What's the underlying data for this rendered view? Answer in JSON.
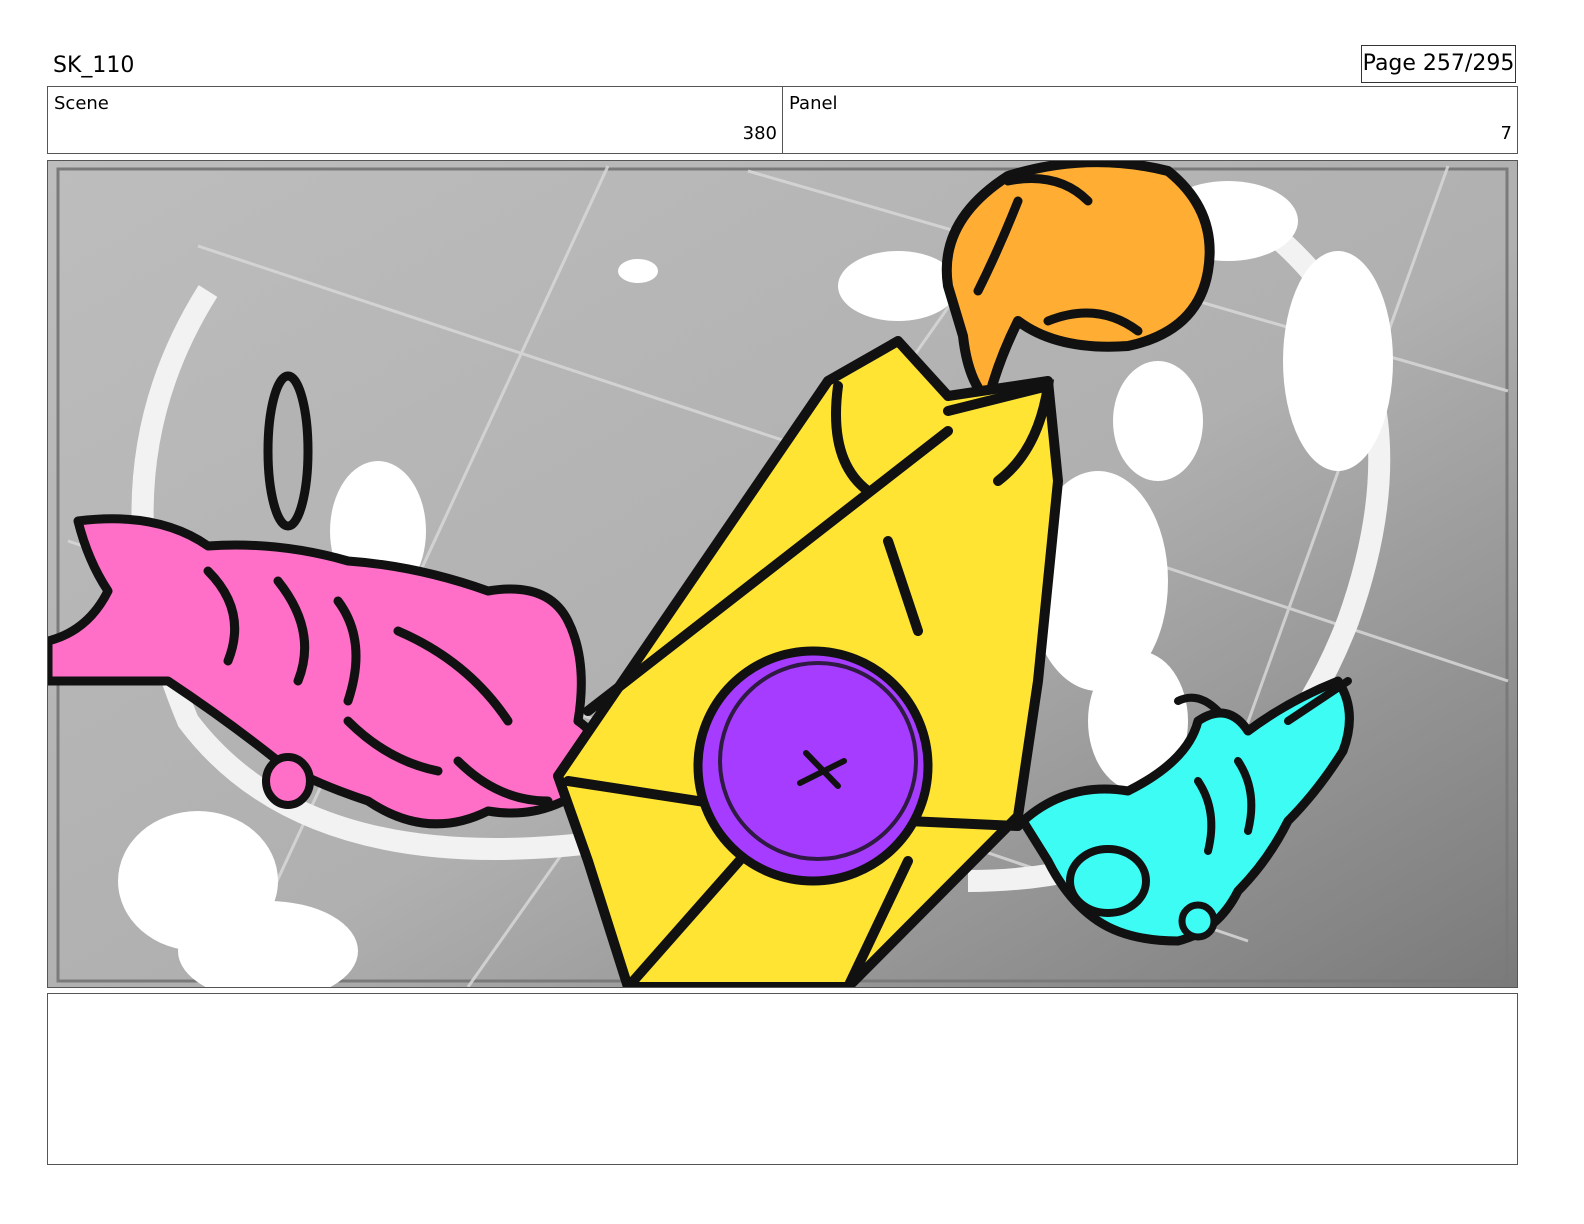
{
  "header": {
    "project_code": "SK_110",
    "page_label": "Page 257/295"
  },
  "info": {
    "scene_label": "Scene",
    "scene_value": "380",
    "panel_label": "Panel",
    "panel_value": "7"
  },
  "artwork": {
    "colors": {
      "background": "#b3b3b3",
      "pink_figure": "#ff6ec7",
      "yellow_figure": "#ffe433",
      "purple_disc": "#a53cff",
      "orange_figure": "#ffad33",
      "cyan_figure": "#3cfcf4",
      "outline": "#111111",
      "clouds": "#ffffff"
    }
  },
  "notes": {
    "text": ""
  }
}
